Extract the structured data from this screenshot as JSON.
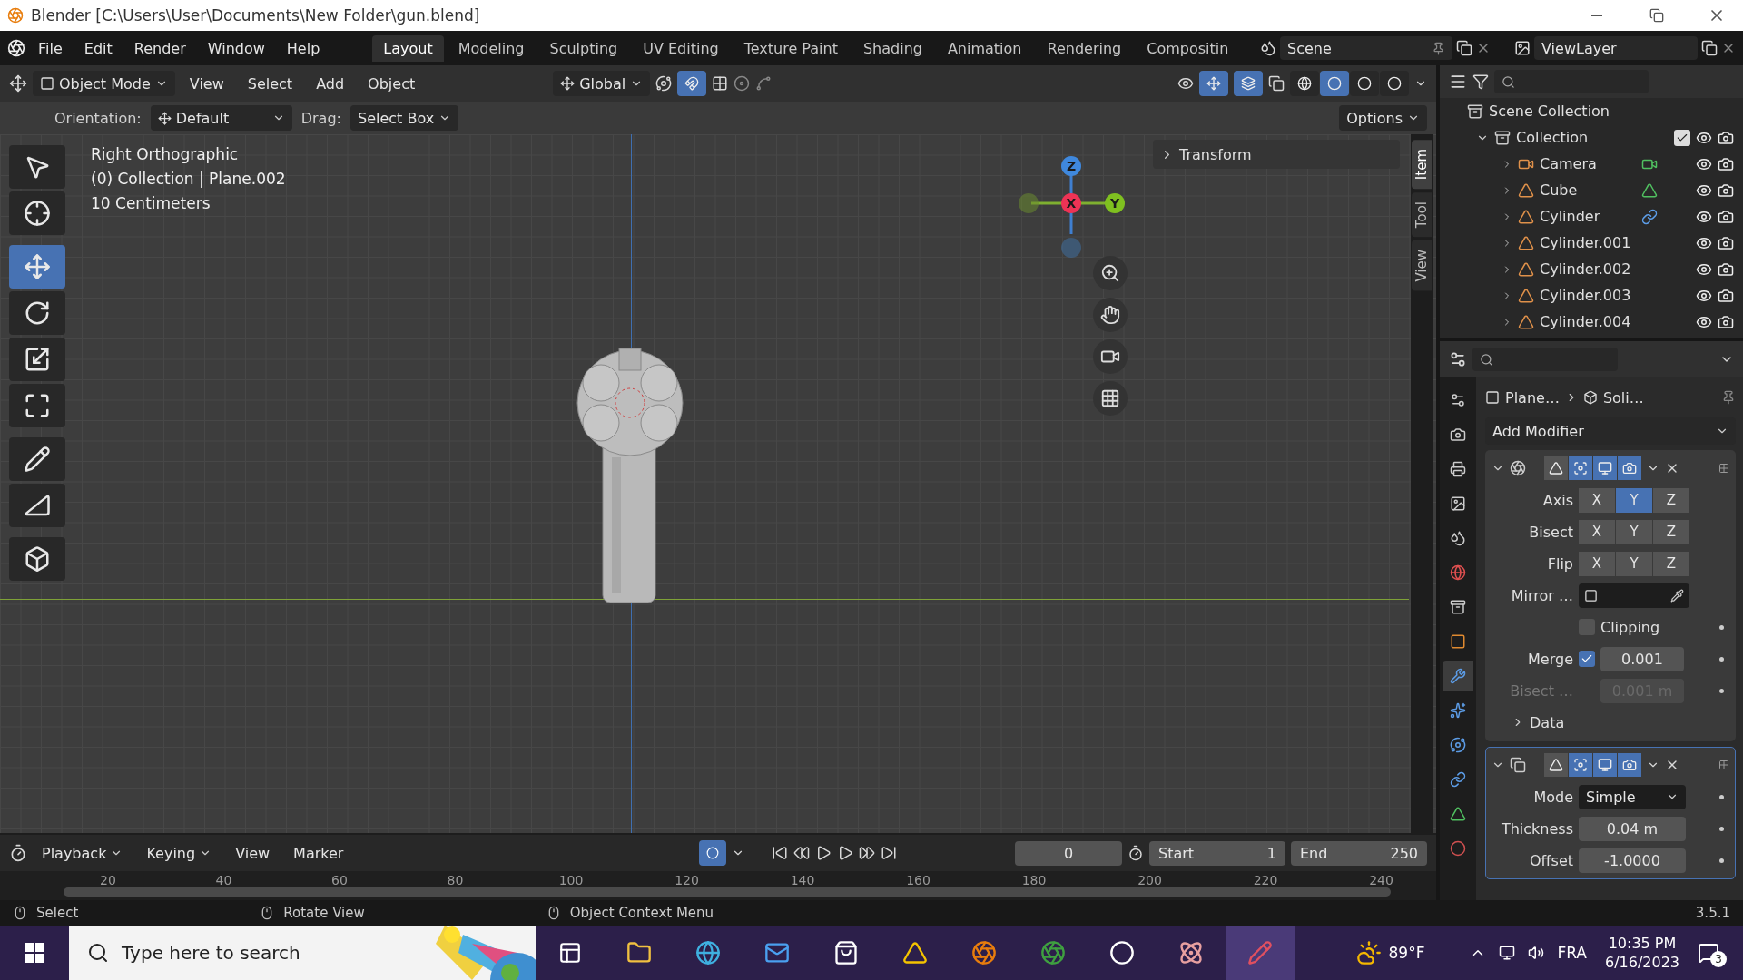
{
  "window": {
    "title": "Blender [C:\\Users\\User\\Documents\\New Folder\\gun.blend]"
  },
  "menu": [
    "File",
    "Edit",
    "Render",
    "Window",
    "Help"
  ],
  "workspaces": [
    {
      "label": "Layout",
      "selected": true
    },
    {
      "label": "Modeling",
      "selected": false
    },
    {
      "label": "Sculpting",
      "selected": false
    },
    {
      "label": "UV Editing",
      "selected": false
    },
    {
      "label": "Texture Paint",
      "selected": false
    },
    {
      "label": "Shading",
      "selected": false
    },
    {
      "label": "Animation",
      "selected": false
    },
    {
      "label": "Rendering",
      "selected": false
    },
    {
      "label": "Compositin",
      "selected": false
    }
  ],
  "scene": "Scene",
  "view_layer": "ViewLayer",
  "viewport_header": {
    "mode": "Object Mode",
    "menus": [
      "View",
      "Select",
      "Add",
      "Object"
    ],
    "orientation": "Global",
    "snap": true,
    "gizmos": true,
    "overlays": true,
    "shading": [
      {
        "kind": "wireframe",
        "selected": false
      },
      {
        "kind": "solid",
        "selected": true
      },
      {
        "kind": "material",
        "selected": false
      },
      {
        "kind": "rendered",
        "selected": false
      }
    ]
  },
  "tool_settings": {
    "orientation_label": "Orientation:",
    "orientation": "Default",
    "drag_label": "Drag:",
    "drag": "Select Box",
    "options": "Options"
  },
  "tools": [
    {
      "kind": "select",
      "selected": false
    },
    {
      "kind": "cursor",
      "selected": false
    },
    {
      "kind": "move",
      "selected": true
    },
    {
      "kind": "rotate",
      "selected": false
    },
    {
      "kind": "scale",
      "selected": false
    },
    {
      "kind": "transform",
      "selected": false
    },
    {
      "kind": "annotate",
      "selected": false
    },
    {
      "kind": "measure",
      "selected": false
    },
    {
      "kind": "add_cube",
      "selected": false
    }
  ],
  "viewport_info": [
    "Right Orthographic",
    "(0) Collection | Plane.002",
    "10 Centimeters"
  ],
  "gizmo": {
    "z": "Z",
    "x": "X",
    "y": "Y"
  },
  "sidebar": {
    "panel": "Transform",
    "tabs": [
      {
        "label": "Item",
        "selected": true
      },
      {
        "label": "Tool",
        "selected": false
      },
      {
        "label": "View",
        "selected": false
      }
    ]
  },
  "outliner": {
    "root": "Scene Collection",
    "collections": [
      {
        "label": "Collection",
        "expanded": true,
        "checked": true,
        "children": [
          {
            "label": "Camera",
            "kind": "camera",
            "expanded": false
          },
          {
            "label": "Cube",
            "kind": "mesh",
            "expanded": false
          },
          {
            "label": "Cylinder",
            "kind": "linked",
            "expanded": false
          },
          {
            "label": "Cylinder.001",
            "kind": "plain",
            "expanded": false
          },
          {
            "label": "Cylinder.002",
            "kind": "plain",
            "expanded": false
          },
          {
            "label": "Cylinder.003",
            "kind": "plain",
            "expanded": false
          },
          {
            "label": "Cylinder.004",
            "kind": "plain",
            "expanded": false
          }
        ]
      }
    ]
  },
  "properties": {
    "tabs": [
      {
        "kind": "tool",
        "selected": false
      },
      {
        "kind": "render",
        "selected": false
      },
      {
        "kind": "output",
        "selected": false
      },
      {
        "kind": "view_layer",
        "selected": false
      },
      {
        "kind": "scene",
        "selected": false
      },
      {
        "kind": "world",
        "selected": false
      },
      {
        "kind": "collection",
        "selected": false
      },
      {
        "kind": "object",
        "selected": false
      },
      {
        "kind": "modifiers",
        "selected": true
      },
      {
        "kind": "particles",
        "selected": false
      },
      {
        "kind": "physics",
        "selected": false
      },
      {
        "kind": "constraints",
        "selected": false
      },
      {
        "kind": "data",
        "selected": false
      },
      {
        "kind": "material",
        "selected": false
      }
    ],
    "breadcrumb": [
      "Plane…",
      "Soli…"
    ],
    "add_modifier": "Add Modifier",
    "mirror": {
      "expanded": true,
      "toggles": [
        {
          "kind": "cage",
          "on": false
        },
        {
          "kind": "edit",
          "on": true
        },
        {
          "kind": "viewport",
          "on": true
        },
        {
          "kind": "render",
          "on": true
        }
      ],
      "axis_rows": [
        {
          "label": "Axis",
          "buttons": [
            {
              "label": "X",
              "selected": false
            },
            {
              "label": "Y",
              "selected": true
            },
            {
              "label": "Z",
              "selected": false
            }
          ]
        },
        {
          "label": "Bisect",
          "buttons": [
            {
              "label": "X",
              "selected": false
            },
            {
              "label": "Y",
              "selected": false
            },
            {
              "label": "Z",
              "selected": false
            }
          ]
        },
        {
          "label": "Flip",
          "buttons": [
            {
              "label": "X",
              "selected": false
            },
            {
              "label": "Y",
              "selected": false
            },
            {
              "label": "Z",
              "selected": false
            }
          ]
        }
      ],
      "mirror_object_label": "Mirror …",
      "clipping": {
        "label": "Clipping",
        "checked": false
      },
      "merge": {
        "label": "Merge",
        "checked": true,
        "value": "0.001"
      },
      "bisect_distance": {
        "label": "Bisect …",
        "value": "0.001 m",
        "disabled": true
      },
      "data": {
        "label": "Data",
        "expanded": false
      }
    },
    "solidify": {
      "expanded": true,
      "toggles": [
        {
          "kind": "cage",
          "on": false
        },
        {
          "kind": "edit",
          "on": true
        },
        {
          "kind": "viewport",
          "on": true
        },
        {
          "kind": "render",
          "on": true
        }
      ],
      "fields": [
        {
          "label": "Mode",
          "value": "Simple",
          "kind": "dropdown"
        },
        {
          "label": "Thickness",
          "value": "0.04 m",
          "kind": "number"
        },
        {
          "label": "Offset",
          "value": "-1.0000",
          "kind": "number"
        }
      ]
    }
  },
  "timeline": {
    "menus": [
      {
        "label": "Playback",
        "dropdown": true
      },
      {
        "label": "Keying",
        "dropdown": true
      },
      {
        "label": "View",
        "dropdown": false
      },
      {
        "label": "Marker",
        "dropdown": false
      }
    ],
    "auto_keying": true,
    "frame": "0",
    "start_label": "Start",
    "start": "1",
    "end_label": "End",
    "end": "250",
    "ticks": [
      "20",
      "40",
      "60",
      "80",
      "100",
      "120",
      "140",
      "160",
      "180",
      "200",
      "220",
      "240"
    ]
  },
  "status_bar": {
    "hints": [
      "Select",
      "Rotate View",
      "Object Context Menu"
    ],
    "version": "3.5.1"
  },
  "taskbar": {
    "search_placeholder": "Type here to search",
    "weather": "89°F",
    "language": "FRA",
    "time": "10:35 PM",
    "date": "6/16/2023",
    "notifications": "3"
  }
}
